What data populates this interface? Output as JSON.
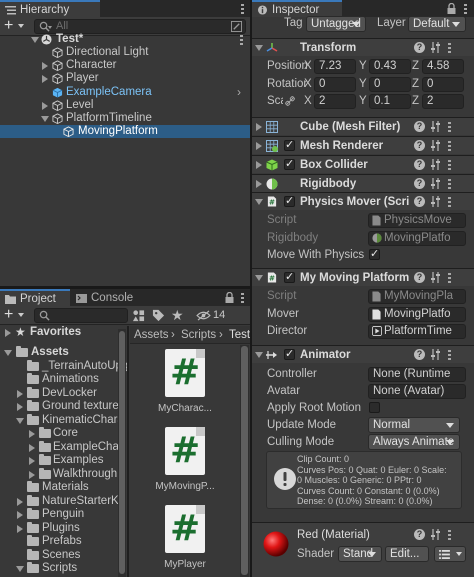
{
  "hierarchy": {
    "tab_label": "Hierarchy",
    "add_label": "+",
    "search_placeholder": "All",
    "items": [
      {
        "label": "Test*"
      },
      {
        "label": "Directional Light"
      },
      {
        "label": "Character"
      },
      {
        "label": "Player"
      },
      {
        "label": "ExampleCamera"
      },
      {
        "label": "Level"
      },
      {
        "label": "PlatformTimeline"
      },
      {
        "label": "MovingPlatform"
      }
    ]
  },
  "project": {
    "tab_label": "Project",
    "console_tab_label": "Console",
    "add_label": "+",
    "hidden_count": "14",
    "favorites_label": "Favorites",
    "assets_label": "Assets",
    "folders": [
      {
        "label": "_TerrainAutoUpg"
      },
      {
        "label": "Animations"
      },
      {
        "label": "DevLocker"
      },
      {
        "label": "Ground textures"
      },
      {
        "label": "KinematicChara"
      },
      {
        "label": "Core"
      },
      {
        "label": "ExampleChar"
      },
      {
        "label": "Examples"
      },
      {
        "label": "Walkthrough"
      },
      {
        "label": "Materials"
      },
      {
        "label": "NatureStarterKit"
      },
      {
        "label": "Penguin"
      },
      {
        "label": "Plugins"
      },
      {
        "label": "Prefabs"
      },
      {
        "label": "Scenes"
      },
      {
        "label": "Scripts"
      }
    ],
    "breadcrumb": [
      "Assets",
      "Scripts",
      "Test"
    ],
    "assets": [
      {
        "label": "MyCharac..."
      },
      {
        "label": "MyMovingP..."
      },
      {
        "label": "MyPlayer"
      }
    ]
  },
  "inspector": {
    "tab_label": "Inspector",
    "tag_label": "Tag",
    "tag_value": "Untagged",
    "layer_label": "Layer",
    "layer_value": "Default",
    "transform": {
      "title": "Transform",
      "position_label": "Position",
      "rotation_label": "Rotation",
      "scale_label": "Scale",
      "x": "X",
      "y": "Y",
      "z": "Z",
      "position": [
        "7.23",
        "0.43",
        "4.58"
      ],
      "rotation": [
        "0",
        "0",
        "0"
      ],
      "scale": [
        "2",
        "0.1",
        "2"
      ]
    },
    "mesh_filter_title": "Cube (Mesh Filter)",
    "mesh_renderer_title": "Mesh Renderer",
    "box_collider_title": "Box Collider",
    "rigidbody_title": "Rigidbody",
    "physics_mover": {
      "title": "Physics Mover (Script",
      "script_label": "Script",
      "script_value": "PhysicsMove",
      "rigidbody_label": "Rigidbody",
      "rigidbody_value": "MovingPlatfo",
      "move_with_physics_label": "Move With Physics"
    },
    "my_moving_platform": {
      "title": "My Moving Platform (S",
      "script_label": "Script",
      "script_value": "MyMovingPla",
      "mover_label": "Mover",
      "mover_value": "MovingPlatfo",
      "director_label": "Director",
      "director_value": "PlatformTime"
    },
    "animator": {
      "title": "Animator",
      "controller_label": "Controller",
      "controller_value": "None (Runtime",
      "avatar_label": "Avatar",
      "avatar_value": "None (Avatar)",
      "apply_root_motion_label": "Apply Root Motion",
      "update_mode_label": "Update Mode",
      "update_mode_value": "Normal",
      "culling_mode_label": "Culling Mode",
      "culling_mode_value": "Always Animate",
      "info_lines": [
        "Clip Count: 0",
        "Curves Pos: 0 Quat: 0 Euler: 0 Scale:",
        "0 Muscles: 0 Generic: 0 PPtr: 0",
        "Curves Count: 0 Constant: 0 (0.0%)",
        "Dense: 0 (0.0%) Stream: 0 (0.0%)"
      ]
    },
    "material": {
      "title": "Red (Material)",
      "shader_label": "Shader",
      "shader_value": "Stand",
      "edit_label": "Edit..."
    }
  },
  "colors": {
    "selection": "#2c5d87",
    "accent_blue": "#3a79bb",
    "prefab_blue": "#5ab4f5",
    "script_green": "#1b6e2f"
  }
}
